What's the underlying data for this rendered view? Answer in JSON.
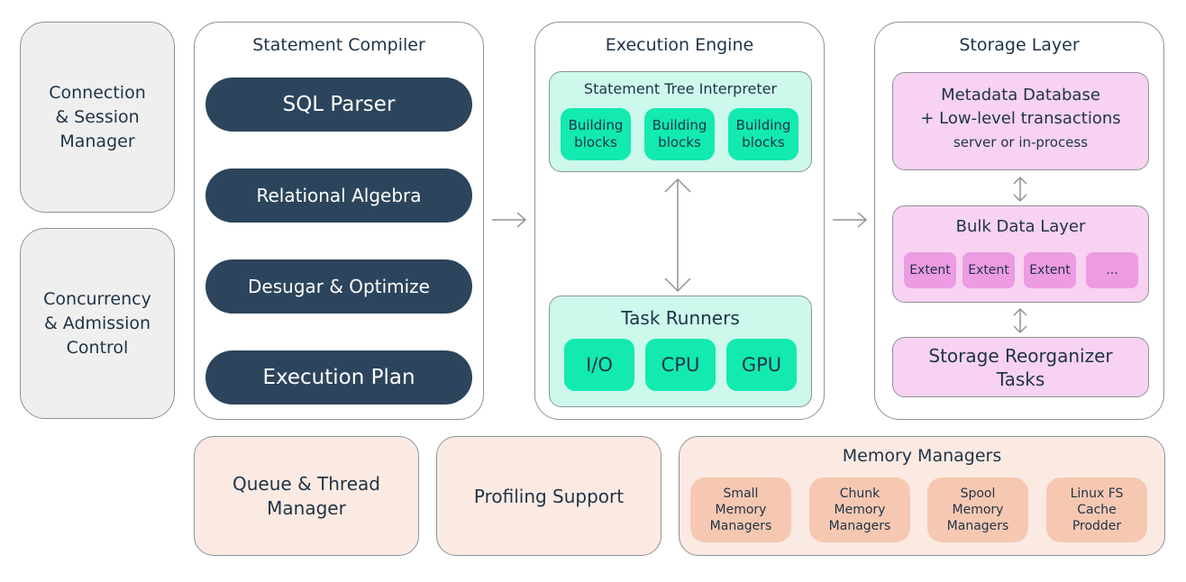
{
  "left_column": {
    "connection": "Connection\n& Session\nManager",
    "concurrency": "Concurrency\n& Admission\nControl"
  },
  "compiler": {
    "title": "Statement Compiler",
    "stages": [
      "SQL Parser",
      "Relational Algebra",
      "Desugar & Optimize",
      "Execution Plan"
    ]
  },
  "engine": {
    "title": "Execution Engine",
    "interpreter": {
      "title": "Statement Tree Interpreter",
      "blocks": [
        "Building\nblocks",
        "Building\nblocks",
        "Building\nblocks"
      ]
    },
    "runners": {
      "title": "Task Runners",
      "items": [
        "I/O",
        "CPU",
        "GPU"
      ]
    }
  },
  "storage": {
    "title": "Storage Layer",
    "metadata": {
      "line1": "Metadata Database",
      "line2": "+ Low-level transactions",
      "line3": "server or in-process"
    },
    "bulk": {
      "title": "Bulk Data Layer",
      "extents": [
        "Extent",
        "Extent",
        "Extent",
        "..."
      ]
    },
    "reorganizer": "Storage Reorganizer\nTasks"
  },
  "bottom": {
    "queue": "Queue & Thread\nManager",
    "profiling": "Profiling Support",
    "memory": {
      "title": "Memory Managers",
      "items": [
        "Small\nMemory\nManagers",
        "Chunk\nMemory\nManagers",
        "Spool\nMemory\nManagers",
        "Linux FS\nCache\nProdder"
      ]
    }
  },
  "colors": {
    "dark_pill": "#2c455c",
    "teal_panel": "#cdf8ec",
    "teal_chip": "#12eab0",
    "pink_panel": "#f7d2f1",
    "pink_chip": "#ed9be2",
    "peach": "#fbeae2",
    "salmon_chip": "#f6c8b2",
    "gray": "#efefef"
  }
}
